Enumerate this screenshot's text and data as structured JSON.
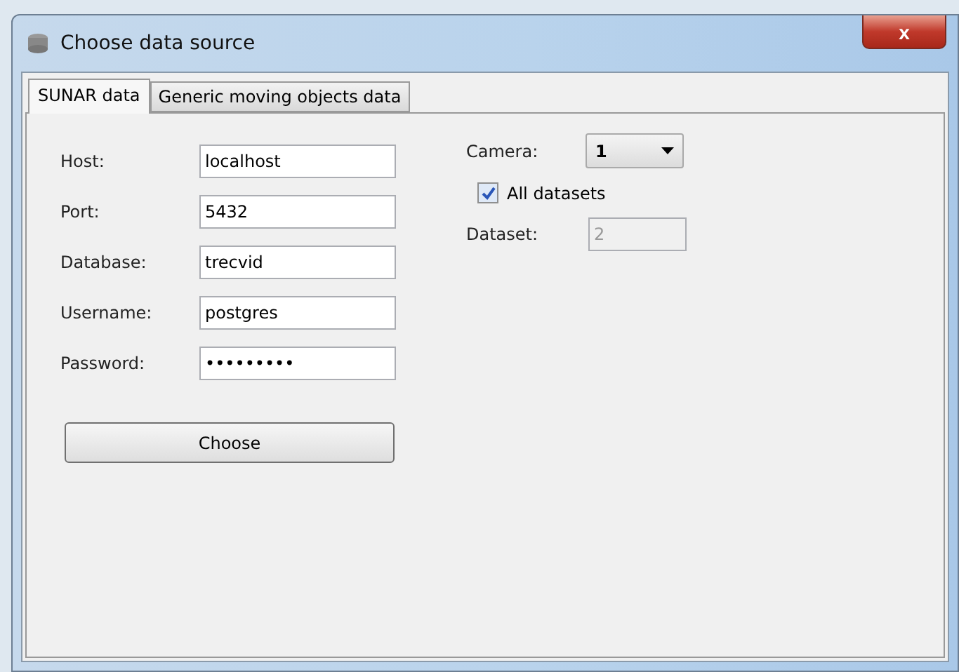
{
  "window": {
    "title": "Choose data source",
    "close_label": "x"
  },
  "tabs": [
    {
      "label": "SUNAR data",
      "selected": true
    },
    {
      "label": "Generic moving objects data",
      "selected": false
    }
  ],
  "form": {
    "fields": [
      {
        "label": "Host:",
        "value": "localhost"
      },
      {
        "label": "Port:",
        "value": "5432"
      },
      {
        "label": "Database:",
        "value": "trecvid"
      },
      {
        "label": "Username:",
        "value": "postgres"
      },
      {
        "label": "Password:",
        "value": "•••••••••"
      }
    ],
    "button": "Choose"
  },
  "camera": {
    "label": "Camera:",
    "value": "1"
  },
  "all_datasets": {
    "label": "All datasets",
    "checked": true
  },
  "dataset": {
    "label": "Dataset:",
    "value": "2",
    "disabled": true
  }
}
